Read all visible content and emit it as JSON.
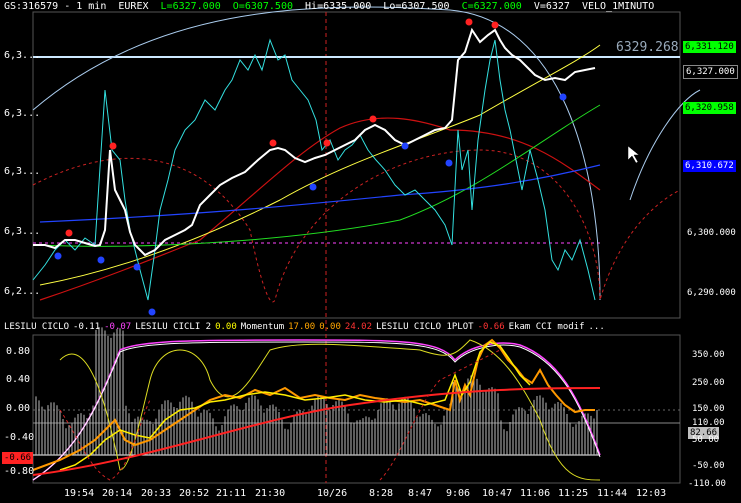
{
  "header": {
    "symbol": "GS:316579 - 1 min",
    "exchange": "EUREX",
    "last": "L=6327.000",
    "open": "O=6307.500",
    "high": "Hi=6335.000",
    "low": "Lo=6307.500",
    "close": "C=6327.000",
    "volume": "V=6327",
    "indicator": "VELO_1MINUTO"
  },
  "price_panel": {
    "y_labels": [
      "6,3...",
      "6,3...",
      "6,3...",
      "6,3...",
      "6,2..."
    ],
    "right_labels": [
      "6,300.000",
      "6,290.000"
    ],
    "watermark": "6329.268",
    "tags": [
      {
        "text": "6,331.120",
        "bg": "#00ff00",
        "fg": "#000000"
      },
      {
        "text": "6,327.000",
        "bg": "#000000",
        "fg": "#ffffff"
      },
      {
        "text": "6,320.958",
        "bg": "#00ff00",
        "fg": "#000000"
      },
      {
        "text": "6,310.672",
        "bg": "#0000ff",
        "fg": "#ffffff"
      }
    ]
  },
  "indicator_panel": {
    "header": [
      {
        "text": "LESILU CICLO",
        "color": "#ffffff"
      },
      {
        "text": "-0.11",
        "color": "#ffffff"
      },
      {
        "text": "-0.07",
        "color": "#ff44ff"
      },
      {
        "text": "LESILU CICLI 2",
        "color": "#ffffff"
      },
      {
        "text": "0.00",
        "color": "#ffff00"
      },
      {
        "text": "Momentum",
        "color": "#ffffff"
      },
      {
        "text": "17.00",
        "color": "#ffa500"
      },
      {
        "text": "0.00",
        "color": "#ffa500"
      },
      {
        "text": "24.02",
        "color": "#ff3333"
      },
      {
        "text": "LESILU CICLO 1PLOT",
        "color": "#ffffff"
      },
      {
        "text": "-0.66",
        "color": "#ff3333"
      },
      {
        "text": "Ekam CCI modif",
        "color": "#ffffff"
      },
      {
        "text": "...",
        "color": "#ffffff"
      }
    ],
    "left_labels": [
      "0.80",
      "0.40",
      "0.00",
      "-0.40",
      "-0.80"
    ],
    "left_tag": "-0.66",
    "right_labels": [
      "350.00",
      "250.00",
      "150.00",
      "110.00",
      "50.00",
      "-50.00"
    ],
    "right_tags": [
      {
        "text": "150.00",
        "bg": "#000000",
        "fg": "#ffffff"
      },
      {
        "text": "82.66",
        "bg": "#c0c0c0",
        "fg": "#000000"
      },
      {
        "text": "-110.00",
        "bg": "#000000",
        "fg": "#ffffff"
      }
    ]
  },
  "x_axis": {
    "labels": [
      "19:54",
      "20:14",
      "20:33",
      "20:52",
      "21:11",
      "21:30",
      "10/26",
      "8:28",
      "8:47",
      "9:06",
      "10:47",
      "11:06",
      "11:25",
      "11:44",
      "12:03"
    ]
  },
  "colors": {
    "price": "#ffffff",
    "cyan": "#33e0e0",
    "yellow": "#ffff44",
    "green": "#22dd22",
    "blue": "#2244ff",
    "red": "#dd1111",
    "orange": "#ff9900",
    "magenta": "#ff44ff"
  }
}
